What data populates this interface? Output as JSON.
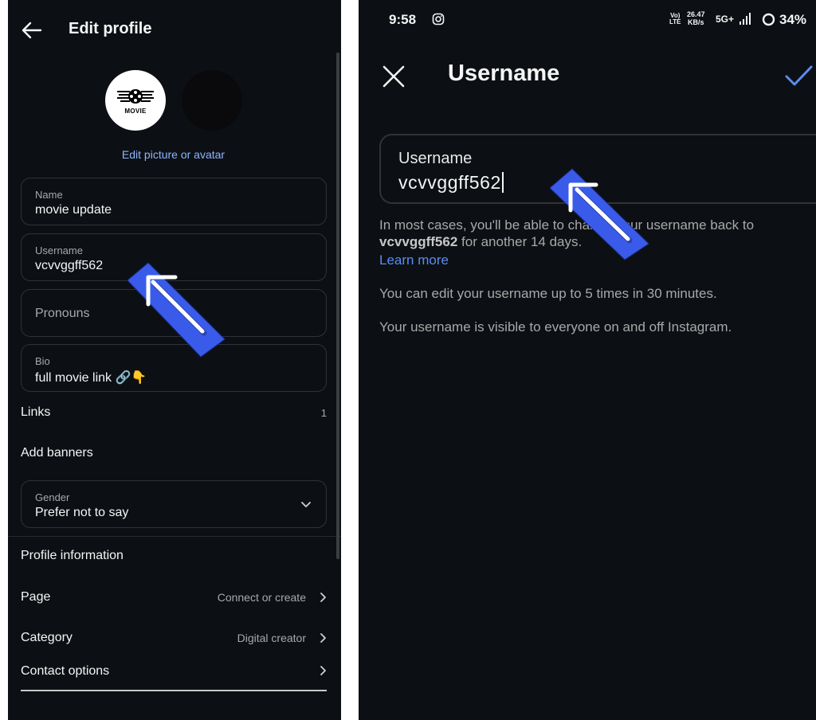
{
  "left": {
    "title": "Edit profile",
    "avatar_text": "MOVIE",
    "edit_picture": "Edit picture or avatar",
    "fields": {
      "name": {
        "label": "Name",
        "value": "movie update"
      },
      "username": {
        "label": "Username",
        "value": "vcvvggff562"
      },
      "pronouns": {
        "placeholder": "Pronouns"
      },
      "bio": {
        "label": "Bio",
        "value": "full movie link 🔗👇"
      },
      "gender": {
        "label": "Gender",
        "value": "Prefer not to say"
      }
    },
    "links": {
      "label": "Links",
      "count": "1"
    },
    "add_banners": "Add banners",
    "profile_information": "Profile information",
    "page": {
      "label": "Page",
      "value": "Connect or create"
    },
    "category": {
      "label": "Category",
      "value": "Digital creator"
    },
    "contact_options": "Contact options"
  },
  "right": {
    "status": {
      "time": "9:58",
      "volte_top": "Vo)",
      "volte_bottom": "LTE",
      "speed_top": "26.47",
      "speed_bottom": "KB/s",
      "network": "5G+",
      "battery": "34%"
    },
    "title": "Username",
    "input": {
      "label": "Username",
      "value": "vcvvggff562"
    },
    "help_prefix": "In most cases, you'll be able to change your username back to",
    "help_username": "vcvvggff562",
    "help_suffix": "for another 14 days.",
    "learn_more": "Learn more",
    "paragraph_edit_limit": "You can edit your username up to 5 times in 30 minutes.",
    "paragraph_visibility": "Your username is visible to everyone on and off Instagram."
  },
  "colors": {
    "background": "#0c1014",
    "accent_link": "#5b8cf0",
    "arrow_blue": "#3a5bea",
    "field_border": "#2f3338"
  }
}
